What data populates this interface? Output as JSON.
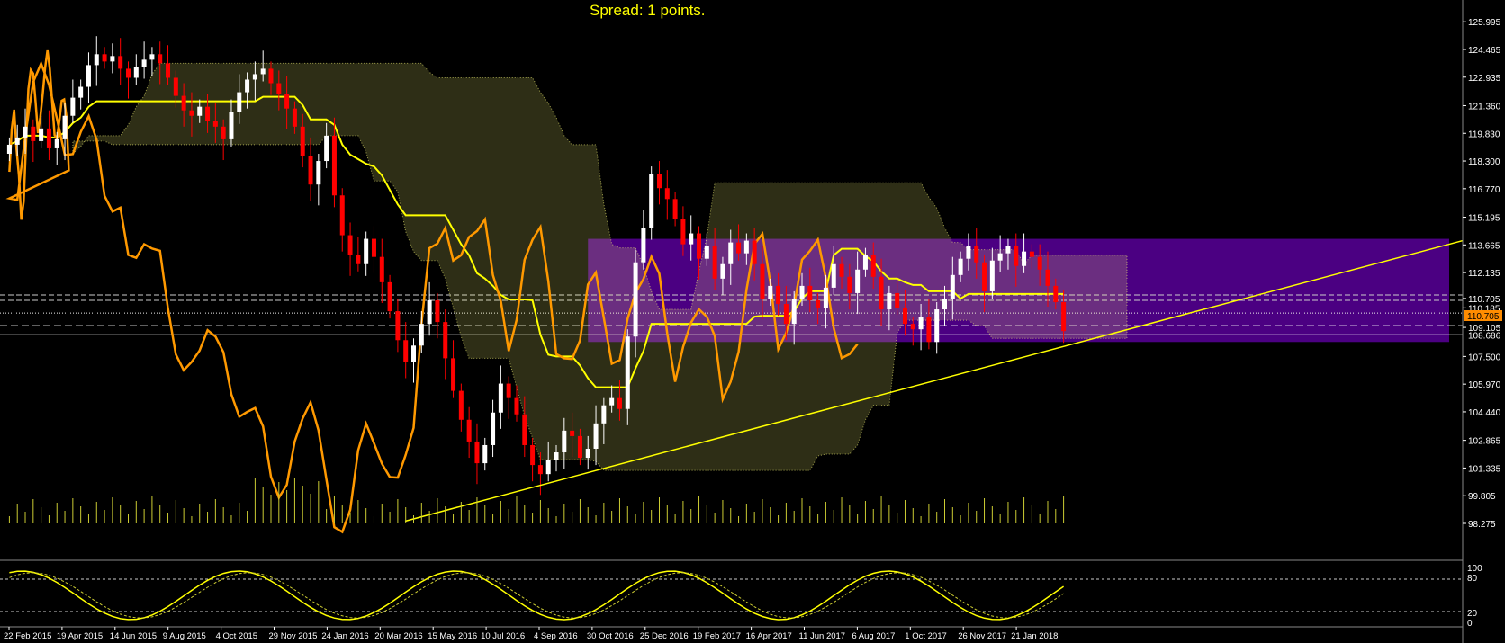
{
  "header": {
    "spread_text": "Spread: 1 points."
  },
  "colors": {
    "background": "#000000",
    "axis": "#ffffff",
    "text": "#ffffff",
    "spread": "#ffff00",
    "bull_candle": "#ffffff",
    "bear_candle": "#ff0000",
    "kijun": "#ffff00",
    "tenkan": "#ffff00",
    "chikou": "#ff9900",
    "cloud": "#ffff66",
    "zone": "#4b0082",
    "trendline": "#ffff00",
    "volume": "#cccc33",
    "stoch_main": "#ffff00",
    "stoch_signal": "#cccc33",
    "price_tag": "#ff8c00"
  },
  "chart_data": {
    "type": "candlestick",
    "title": "",
    "price_axis": [
      "125.995",
      "124.465",
      "122.935",
      "121.360",
      "119.830",
      "118.300",
      "116.770",
      "115.195",
      "113.665",
      "112.135",
      "110.705",
      "110.185",
      "109.105",
      "108.686",
      "107.500",
      "105.970",
      "104.440",
      "102.865",
      "101.335",
      "99.805",
      "98.275"
    ],
    "y_range": [
      98.275,
      126.8
    ],
    "current_price": "110.705",
    "x_labels": [
      "22 Feb 2015",
      "19 Apr 2015",
      "14 Jun 2015",
      "9 Aug 2015",
      "4 Oct 2015",
      "29 Nov 2015",
      "24 Jan 2016",
      "20 Mar 2016",
      "15 May 2016",
      "10 Jul 2016",
      "4 Sep 2016",
      "30 Oct 2016",
      "25 Dec 2016",
      "19 Feb 2017",
      "16 Apr 2017",
      "11 Jun 2017",
      "6 Aug 2017",
      "1 Oct 2017",
      "26 Nov 2017",
      "21 Jan 2018"
    ],
    "closes": [
      119.2,
      119.6,
      120.2,
      119.4,
      120.1,
      119.0,
      119.5,
      120.8,
      121.8,
      122.4,
      123.6,
      124.2,
      123.8,
      124.1,
      123.4,
      122.9,
      123.5,
      123.9,
      124.2,
      123.7,
      122.9,
      121.9,
      121.1,
      120.8,
      121.3,
      120.5,
      120.2,
      119.5,
      121.0,
      122.1,
      122.8,
      123.1,
      123.4,
      122.6,
      122.0,
      121.2,
      120.2,
      118.6,
      117.0,
      118.3,
      119.7,
      116.4,
      114.2,
      113.1,
      112.6,
      114.0,
      113.0,
      111.6,
      110.0,
      108.4,
      107.2,
      108.1,
      109.3,
      110.6,
      109.4,
      107.4,
      105.6,
      104.0,
      102.8,
      101.6,
      102.6,
      104.4,
      106.0,
      105.2,
      104.3,
      102.6,
      101.5,
      101.0,
      101.8,
      102.2,
      103.4,
      103.1,
      101.9,
      102.4,
      103.8,
      104.8,
      105.2,
      104.6,
      108.6,
      112.7,
      114.6,
      117.6,
      116.8,
      116.2,
      115.1,
      113.7,
      114.3,
      112.9,
      113.6,
      111.8,
      112.6,
      113.8,
      113.2,
      113.9,
      112.6,
      110.7,
      111.4,
      110.4,
      109.3,
      110.7,
      111.4,
      110.6,
      110.2,
      111.3,
      112.6,
      111.9,
      111.0,
      112.3,
      113.1,
      111.9,
      110.1,
      111.0,
      110.2,
      109.3,
      109.0,
      109.7,
      108.3,
      110.1,
      110.7,
      112.0,
      112.9,
      113.6,
      112.7,
      111.1,
      112.8,
      113.2,
      113.6,
      112.5,
      113.3,
      113.0,
      112.3,
      111.4,
      110.5,
      108.9
    ],
    "volume_note": "tick volume bars below price",
    "trendline": {
      "from": [
        "20 Mar 2016",
        98.4
      ],
      "to": [
        "21 Jan 2018+",
        113.8
      ]
    },
    "zone": {
      "from": "Sep 2016",
      "to": "end",
      "low": 108.3,
      "high": 114.0
    },
    "oscillator": {
      "levels": [
        "100",
        "80",
        "20",
        "0"
      ]
    }
  }
}
